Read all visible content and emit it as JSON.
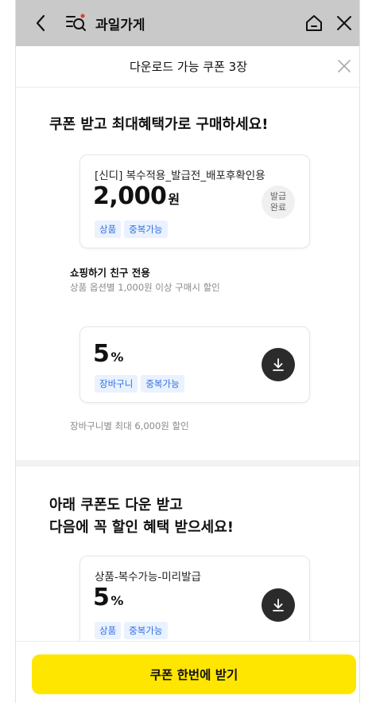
{
  "appbar": {
    "store_name": "과일가게",
    "icons": [
      "chevron-left-icon",
      "store-search-icon",
      "home-icon",
      "close-icon"
    ]
  },
  "sheet": {
    "title": "다운로드 가능 쿠폰 3장"
  },
  "section1": {
    "heading": "쿠폰 받고 최대혜택가로 구매하세요!",
    "coupons": [
      {
        "name": "[신디] 복수적용_발급전_배포후확인용",
        "amount": "2,000",
        "unit": "원",
        "badges": [
          "상품",
          "중복가능"
        ],
        "status": "발급\n완료",
        "note_title": "쇼핑하기 친구 전용",
        "note_desc": "상품 옵션별 1,000원 이상 구매시 할인"
      },
      {
        "name": "",
        "amount": "5",
        "unit": "%",
        "badges": [
          "장바구니",
          "중복가능"
        ],
        "note_desc": "장바구니별 최대 6,000원 할인"
      }
    ]
  },
  "section2": {
    "heading_line1": "아래 쿠폰도 다운 받고",
    "heading_line2": "다음에 꼭 할인 혜택 받으세요!",
    "coupons": [
      {
        "name": "상품-복수가능-미리발급",
        "amount": "5",
        "unit": "%",
        "badges": [
          "상품",
          "중복가능"
        ]
      }
    ]
  },
  "cta": {
    "label": "쿠폰 한번에 받기"
  },
  "colors": {
    "accent": "#ffe600",
    "badge_bg": "#eaf2ff",
    "badge_text": "#2f6fe0",
    "appbar_bg": "#c9c9c9"
  }
}
